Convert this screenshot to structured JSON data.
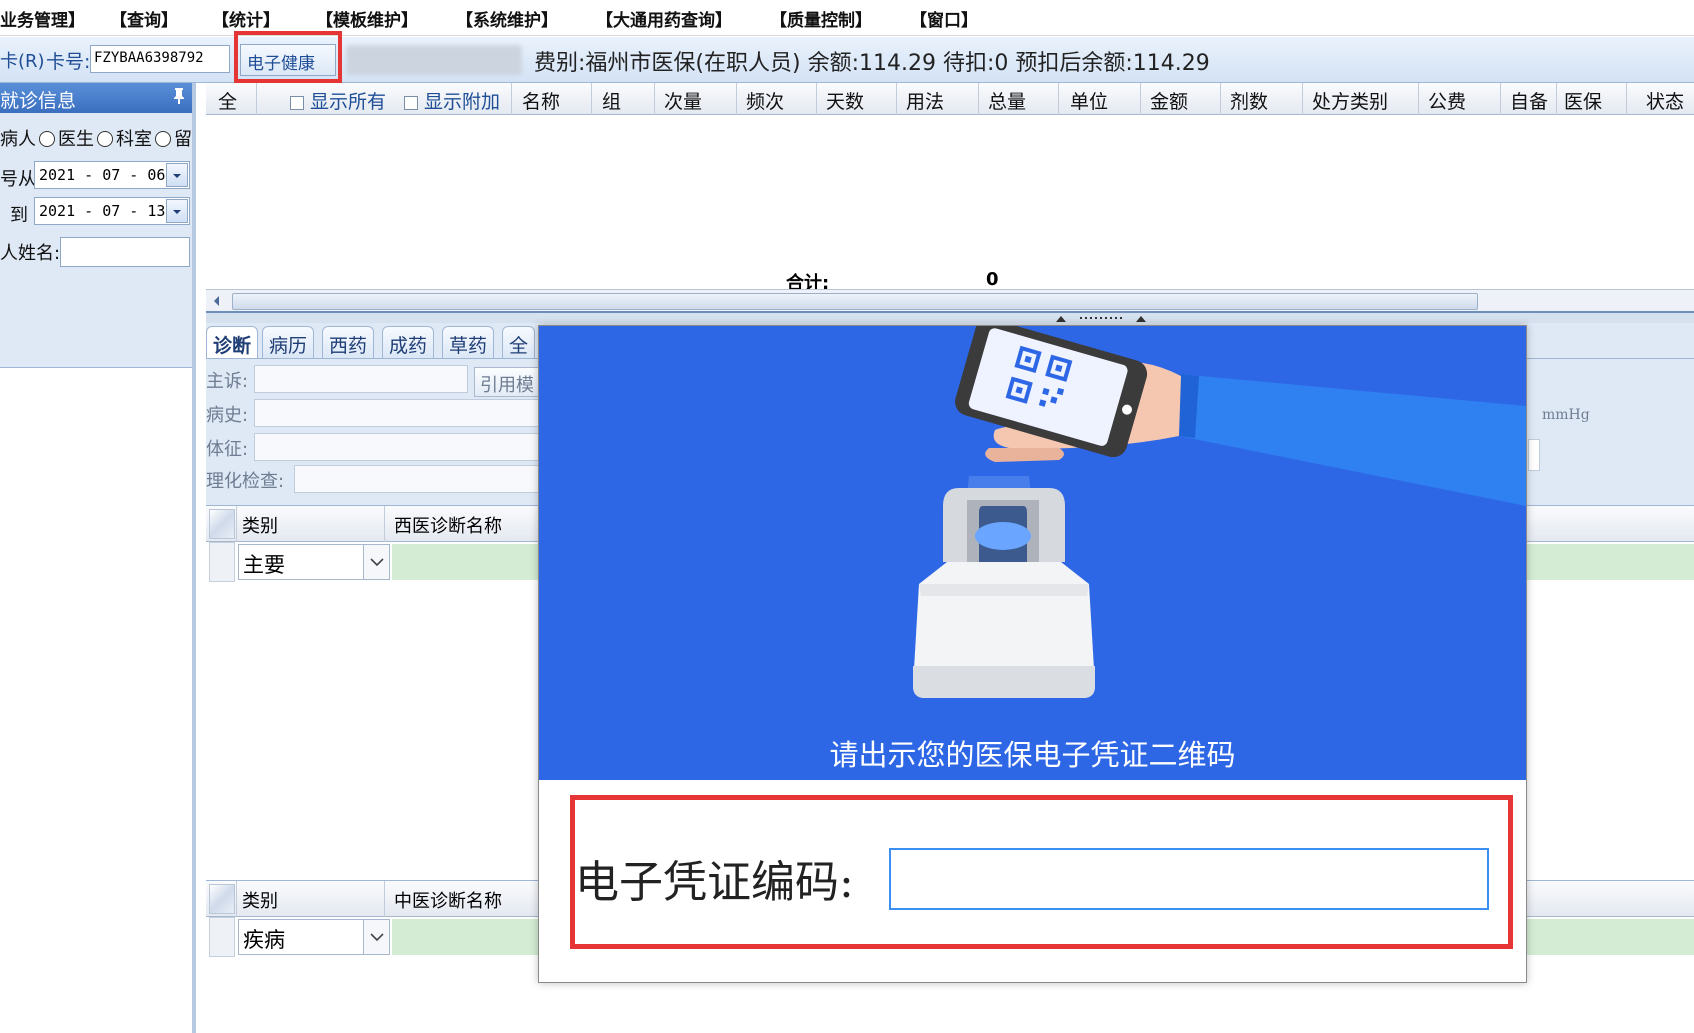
{
  "menu": {
    "items": [
      "业务管理】",
      "【查询】",
      "【统计】",
      "【模板维护】",
      "【系统维护】",
      "【大通用药查询】",
      "【质量控制】",
      "【窗口】"
    ]
  },
  "toolbar": {
    "read_card_label": "卡(R)",
    "card_no_label": "卡号:",
    "card_no_value": "FZYBAA6398792",
    "ehc_button_label": "电子健康卡",
    "fee_info": "费别:福州市医保(在职人员) 余额:114.29 待扣:0 预扣后余额:114.29"
  },
  "left_panel": {
    "title": "就诊信息",
    "pin_icon": "pin-icon",
    "radio_prefix": "病人",
    "radio_options": [
      "医生",
      "科室",
      "留"
    ],
    "from_label": "号从",
    "from_date": "2021 - 07 - 06",
    "to_label": "到",
    "to_date": "2021 - 07 - 13",
    "name_label": "人姓名:",
    "name_value": ""
  },
  "top_grid": {
    "columns": [
      "全",
      "显示所有",
      "显示附加",
      "名称",
      "组",
      "次量",
      "频次",
      "天数",
      "用法",
      "总量",
      "单位",
      "金额",
      "剂数",
      "处方类别",
      "公费",
      "自备",
      "医保",
      "状态"
    ],
    "total_label": "合计:",
    "total_value": "0"
  },
  "tabs": [
    "诊断",
    "病历",
    "西药",
    "成药",
    "草药",
    "全"
  ],
  "form": {
    "chief_complaint_label": "主诉:",
    "history_label": "病史:",
    "signs_label": "体征:",
    "exam_label": "理化检查:",
    "ref_template_label": "引用模",
    "unit_mmhg": "mmHg"
  },
  "western_diag": {
    "col_type": "类别",
    "col_name": "西医诊断名称",
    "type_value": "主要"
  },
  "tcm_diag": {
    "col_type": "类别",
    "col_name": "中医诊断名称",
    "type_value": "疾病"
  },
  "modal": {
    "prompt": "请出示您的医保电子凭证二维码",
    "code_label": "电子凭证编码:",
    "code_value": "",
    "colors": {
      "banner": "#2e67e6",
      "highlight": "#e53535"
    }
  }
}
